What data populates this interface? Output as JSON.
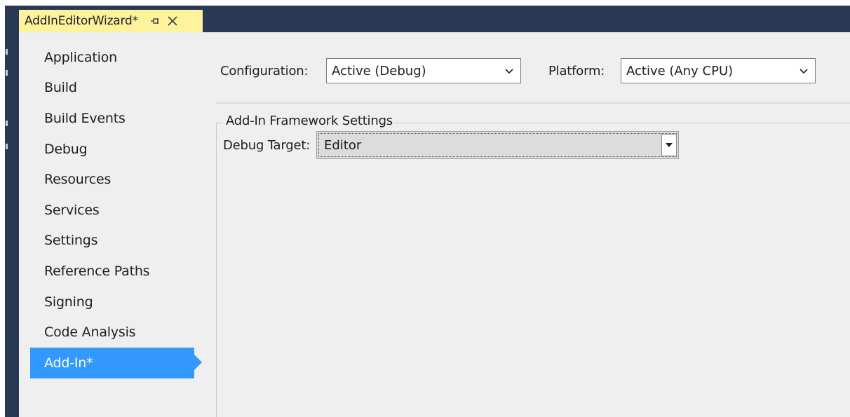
{
  "tab": {
    "title": "AddInEditorWizard*"
  },
  "nav": {
    "items": [
      {
        "label": "Application"
      },
      {
        "label": "Build"
      },
      {
        "label": "Build Events"
      },
      {
        "label": "Debug"
      },
      {
        "label": "Resources"
      },
      {
        "label": "Services"
      },
      {
        "label": "Settings"
      },
      {
        "label": "Reference Paths"
      },
      {
        "label": "Signing"
      },
      {
        "label": "Code Analysis"
      },
      {
        "label": "Add-In*"
      }
    ],
    "selected": "Add-In*"
  },
  "config": {
    "configuration_label": "Configuration:",
    "configuration_value": "Active (Debug)",
    "platform_label": "Platform:",
    "platform_value": "Active (Any CPU)"
  },
  "addin": {
    "group_title": "Add-In Framework Settings",
    "debug_target_label": "Debug Target:",
    "debug_target_value": "Editor"
  },
  "icons": {
    "pin": "pin-icon",
    "close": "close-icon",
    "chevron": "chevron-down-icon",
    "dropdown_arrow": "dropdown-arrow-icon"
  },
  "colors": {
    "tab_active": "#fff29d",
    "ide_background": "#293955",
    "selection": "#3399ff",
    "panel": "#efefef"
  }
}
